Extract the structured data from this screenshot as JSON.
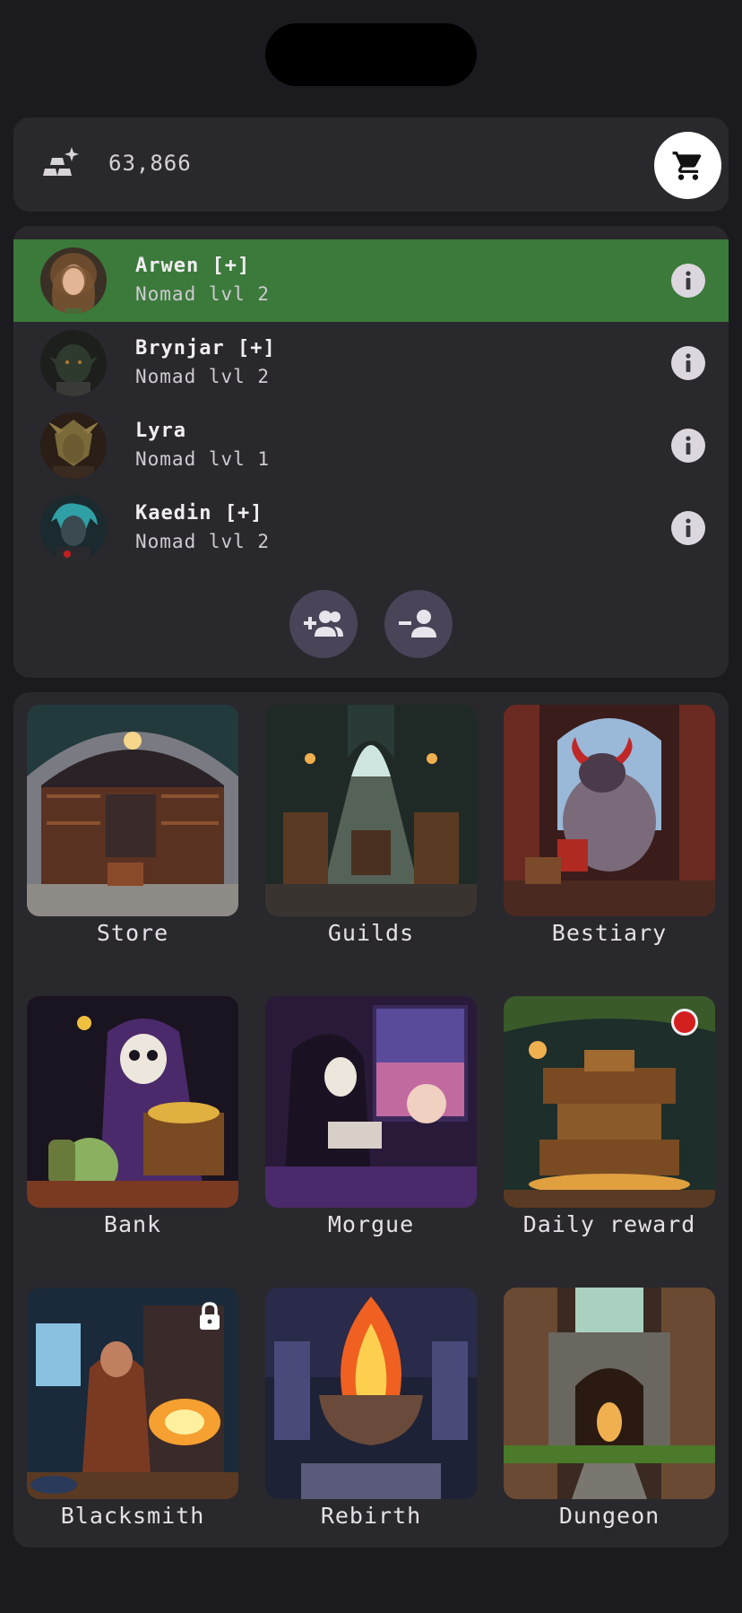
{
  "currency": {
    "amount": "63,866",
    "icon": "gold-bars-icon"
  },
  "store_button": {
    "icon": "cart-icon"
  },
  "party": {
    "characters": [
      {
        "name": "Arwen [+]",
        "class_level": "Nomad lvl 2",
        "selected": true,
        "portrait": "elf-woman-portrait"
      },
      {
        "name": "Brynjar [+]",
        "class_level": "Nomad lvl 2",
        "selected": false,
        "portrait": "orc-portrait"
      },
      {
        "name": "Lyra",
        "class_level": "Nomad lvl 1",
        "selected": false,
        "portrait": "lizardfolk-portrait"
      },
      {
        "name": "Kaedin [+]",
        "class_level": "Nomad lvl 2",
        "selected": false,
        "portrait": "undead-portrait"
      }
    ],
    "add_button_icon": "add-group-icon",
    "remove_button_icon": "remove-person-icon"
  },
  "locations": [
    {
      "label": "Store",
      "image": "store-shelves-image"
    },
    {
      "label": "Guilds",
      "image": "guild-hall-image"
    },
    {
      "label": "Bestiary",
      "image": "minotaur-library-image"
    },
    {
      "label": "Bank",
      "image": "reaper-treasure-image"
    },
    {
      "label": "Morgue",
      "image": "reaper-reading-image"
    },
    {
      "label": "Daily reward",
      "image": "treasure-chests-image",
      "notification": true
    },
    {
      "label": "Blacksmith",
      "image": "forge-image",
      "locked": true
    },
    {
      "label": "Rebirth",
      "image": "fire-brazier-image"
    },
    {
      "label": "Dungeon",
      "image": "dungeon-gate-image"
    }
  ],
  "colors": {
    "background": "#1b1a1e",
    "panel": "#29282c",
    "selected_row": "#3b7a3a",
    "party_button": "#4a4458",
    "notification": "#d41f1f"
  }
}
